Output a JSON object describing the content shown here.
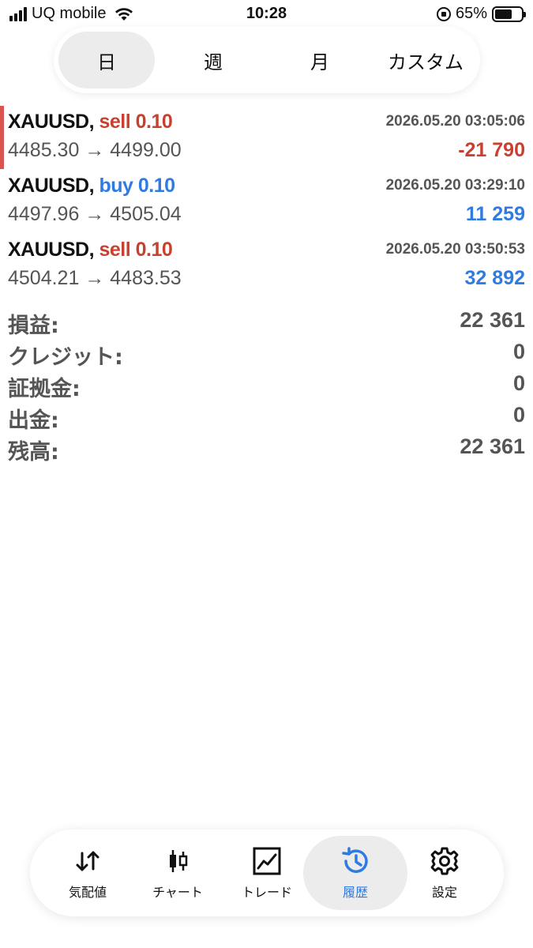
{
  "status_bar": {
    "carrier": "UQ mobile",
    "time": "10:28",
    "battery_percent": "65%",
    "battery_level": 0.65
  },
  "period_tabs": [
    {
      "label": "日",
      "active": true
    },
    {
      "label": "週",
      "active": false
    },
    {
      "label": "月",
      "active": false
    },
    {
      "label": "カスタム",
      "active": false
    }
  ],
  "trades": [
    {
      "symbol": "XAUUSD,",
      "direction": "sell 0.10",
      "side": "sell",
      "time": "2026.05.20 03:05:06",
      "prices": "4485.30 → 4499.00",
      "profit": "-21 790",
      "profit_sign": "neg"
    },
    {
      "symbol": "XAUUSD,",
      "direction": "buy 0.10",
      "side": "buy",
      "time": "2026.05.20 03:29:10",
      "prices": "4497.96 → 4505.04",
      "profit": "11 259",
      "profit_sign": "pos"
    },
    {
      "symbol": "XAUUSD,",
      "direction": "sell 0.10",
      "side": "sell",
      "time": "2026.05.20 03:50:53",
      "prices": "4504.21 → 4483.53",
      "profit": "32 892",
      "profit_sign": "pos"
    }
  ],
  "summary": [
    {
      "label": "損益:",
      "value": "22 361"
    },
    {
      "label": "クレジット:",
      "value": "0"
    },
    {
      "label": "証拠金:",
      "value": "0"
    },
    {
      "label": "出金:",
      "value": "0"
    },
    {
      "label": "残高:",
      "value": "22 361"
    }
  ],
  "bottom_nav": [
    {
      "label": "気配値",
      "icon": "arrows-updown-icon",
      "active": false
    },
    {
      "label": "チャート",
      "icon": "candlestick-icon",
      "active": false
    },
    {
      "label": "トレード",
      "icon": "trade-chart-icon",
      "active": false
    },
    {
      "label": "履歴",
      "icon": "history-icon",
      "active": true
    },
    {
      "label": "設定",
      "icon": "gear-icon",
      "active": false
    }
  ],
  "colors": {
    "sell": "#c8412e",
    "buy": "#2f7be0",
    "accent": "#2f7be0"
  }
}
